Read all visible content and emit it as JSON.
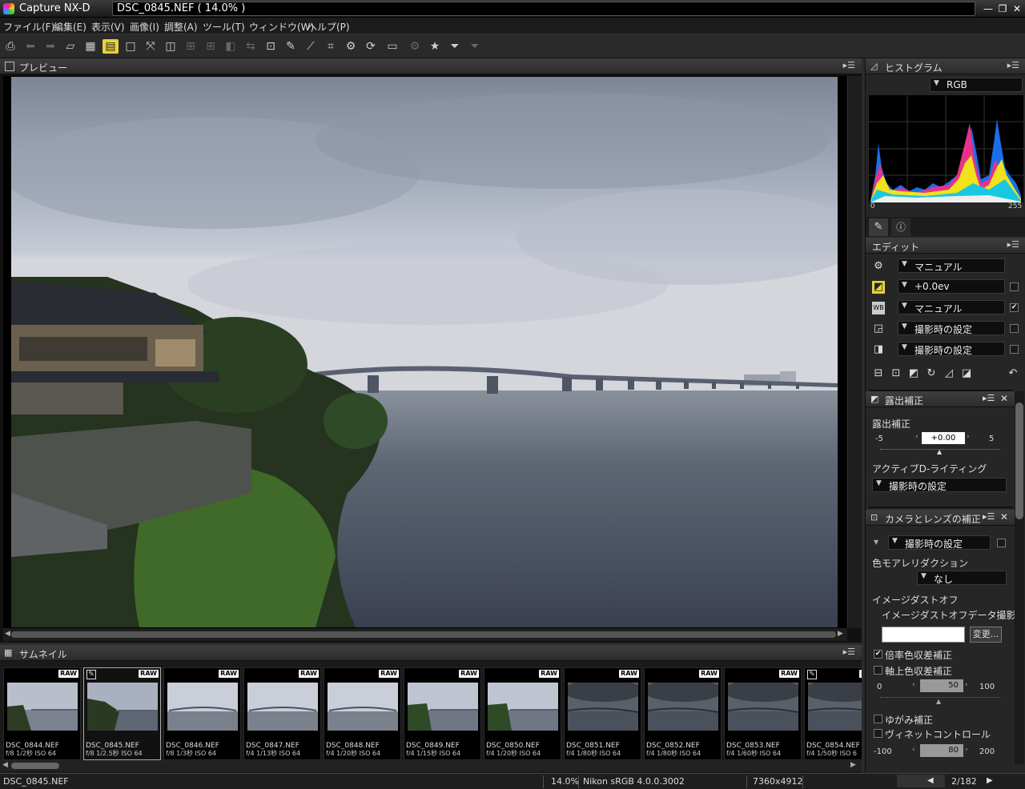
{
  "window": {
    "app": "Capture NX-D",
    "file_title": "DSC_0845.NEF ( 14.0% )"
  },
  "menu": [
    "ファイル(F)",
    "編集(E)",
    "表示(V)",
    "画像(I)",
    "調整(A)",
    "ツール(T)",
    "ウィンドウ(W)",
    "ヘルプ(P)"
  ],
  "preview": {
    "title": "プレビュー"
  },
  "histogram": {
    "title": "ヒストグラム",
    "channel": "RGB",
    "min": "0",
    "max": "255"
  },
  "edit": {
    "title": "エディット",
    "rows": [
      {
        "icon": "gear-icon",
        "value": "マニュアル",
        "checked": null
      },
      {
        "icon": "exposure-icon",
        "value": "+0.0ev",
        "checked": false
      },
      {
        "icon": "wb-icon",
        "value": "マニュアル",
        "checked": true
      },
      {
        "icon": "picture-control-icon",
        "value": "撮影時の設定",
        "checked": false
      },
      {
        "icon": "tone-icon",
        "value": "撮影時の設定",
        "checked": false
      }
    ]
  },
  "exposure": {
    "title": "露出補正",
    "label": "露出補正",
    "value": "+0.00",
    "min": "-5",
    "max": "5",
    "adl_label": "アクティブD-ライティング",
    "adl_value": "撮影時の設定"
  },
  "camera_lens": {
    "title": "カメラとレンズの補正",
    "setting": "撮影時の設定",
    "moire_label": "色モアレリダクション",
    "moire_value": "なし",
    "dust_label": "イメージダストオフ",
    "dust_sub": "イメージダストオフデータ撮影日",
    "change_button": "変更...",
    "lateral_ca": {
      "label": "倍率色収差補正",
      "checked": true
    },
    "axial_ca": {
      "label": "軸上色収差補正",
      "checked": false
    },
    "axial_slider": {
      "min": "0",
      "value": "50",
      "max": "100"
    },
    "distortion": {
      "label": "ゆがみ補正",
      "checked": false
    },
    "vignette": {
      "label": "ヴィネットコントロール",
      "checked": false
    },
    "vignette_slider": {
      "min": "-100",
      "value": "80",
      "max": "200"
    }
  },
  "thumbnails": {
    "title": "サムネイル",
    "items": [
      {
        "name": "DSC_0844.NEF",
        "info": "f/8 1/2秒 ISO 64",
        "edited": false,
        "selected": false,
        "scene": "a"
      },
      {
        "name": "DSC_0845.NEF",
        "info": "f/8 1/2.5秒 ISO 64",
        "edited": true,
        "selected": true,
        "scene": "b"
      },
      {
        "name": "DSC_0846.NEF",
        "info": "f/8 1/3秒 ISO 64",
        "edited": false,
        "selected": false,
        "scene": "c"
      },
      {
        "name": "DSC_0847.NEF",
        "info": "f/4 1/13秒 ISO 64",
        "edited": false,
        "selected": false,
        "scene": "c"
      },
      {
        "name": "DSC_0848.NEF",
        "info": "f/4 1/20秒 ISO 64",
        "edited": false,
        "selected": false,
        "scene": "c"
      },
      {
        "name": "DSC_0849.NEF",
        "info": "f/4 1/15秒 ISO 64",
        "edited": false,
        "selected": false,
        "scene": "d"
      },
      {
        "name": "DSC_0850.NEF",
        "info": "f/4 1/20秒 ISO 64",
        "edited": false,
        "selected": false,
        "scene": "d"
      },
      {
        "name": "DSC_0851.NEF",
        "info": "f/4 1/80秒 ISO 64",
        "edited": false,
        "selected": false,
        "scene": "e"
      },
      {
        "name": "DSC_0852.NEF",
        "info": "f/4 1/80秒 ISO 64",
        "edited": false,
        "selected": false,
        "scene": "e"
      },
      {
        "name": "DSC_0853.NEF",
        "info": "f/4 1/60秒 ISO 64",
        "edited": false,
        "selected": false,
        "scene": "e"
      },
      {
        "name": "DSC_0854.NEF",
        "info": "f/4 1/50秒 ISO 6",
        "edited": true,
        "selected": false,
        "scene": "e"
      }
    ],
    "raw_badge": "RAW"
  },
  "status": {
    "file": "DSC_0845.NEF",
    "zoom": "14.0%",
    "profile": "Nikon sRGB 4.0.0.3002",
    "dimensions": "7360x4912",
    "page": "2/182"
  }
}
